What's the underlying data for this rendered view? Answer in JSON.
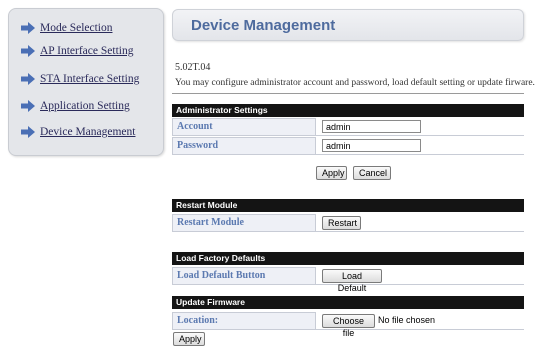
{
  "sidebar": {
    "items": [
      {
        "label": "Mode Selection"
      },
      {
        "label": "AP Interface Setting"
      },
      {
        "label": "STA Interface Setting"
      },
      {
        "label": "Application Setting"
      },
      {
        "label": "Device Management"
      }
    ]
  },
  "header": {
    "title": "Device Management"
  },
  "version": "5.02T.04",
  "description": "You may configure administrator account and password, load default setting or update firware.",
  "admin": {
    "title": "Administrator Settings",
    "account_label": "Account",
    "account_value": "admin",
    "password_label": "Password",
    "password_value": "admin",
    "apply_label": "Apply",
    "cancel_label": "Cancel"
  },
  "restart": {
    "title": "Restart Module",
    "row_label": "Restart Module",
    "button_label": "Restart"
  },
  "defaults": {
    "title": "Load Factory Defaults",
    "row_label": "Load Default Button",
    "button_label": "Load Default"
  },
  "firmware": {
    "title": "Update Firmware",
    "row_label": "Location:",
    "choose_label": "Choose file",
    "file_status": "No file chosen",
    "apply_label": "Apply"
  },
  "colors": {
    "accent": "#5b79b0",
    "header_title": "#4e6b9e",
    "section_bg": "#141414",
    "arrow": "#4a6fb5"
  },
  "icons": {
    "sidebar_arrow": "arrow-right-icon"
  }
}
